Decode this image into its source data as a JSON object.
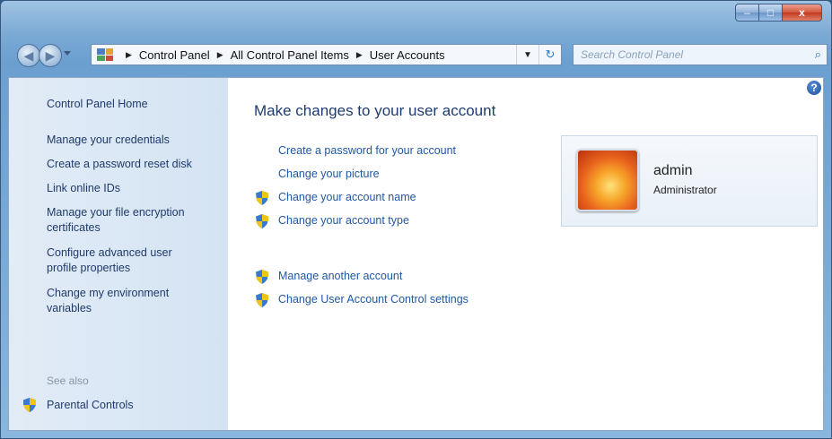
{
  "window": {
    "caption": {
      "minimize": "–",
      "maximize": "□",
      "close": "x"
    }
  },
  "nav": {
    "back": "◀",
    "forward": "▶",
    "breadcrumb": [
      "Control Panel",
      "All Control Panel Items",
      "User Accounts"
    ],
    "separator": "▶",
    "dropdown": "▼",
    "refresh": "↻",
    "search_placeholder": "Search Control Panel",
    "search_icon": "⌕"
  },
  "sidebar": {
    "home": "Control Panel Home",
    "links": [
      "Manage your credentials",
      "Create a password reset disk",
      "Link online IDs",
      "Manage your file encryption certificates",
      "Configure advanced user profile properties",
      "Change my environment variables"
    ],
    "see_also": "See also",
    "parental_controls": "Parental Controls"
  },
  "main": {
    "help": "?",
    "title": "Make changes to your user account",
    "tasks": [
      "Create a password for your account",
      "Change your picture",
      "Change your account name",
      "Change your account type",
      "Manage another account",
      "Change User Account Control settings"
    ]
  },
  "account": {
    "name": "admin",
    "role": "Administrator"
  },
  "colors": {
    "link": "#1f58a6",
    "sidebar_link": "#1f3a6a",
    "title": "#1e3b6d"
  }
}
